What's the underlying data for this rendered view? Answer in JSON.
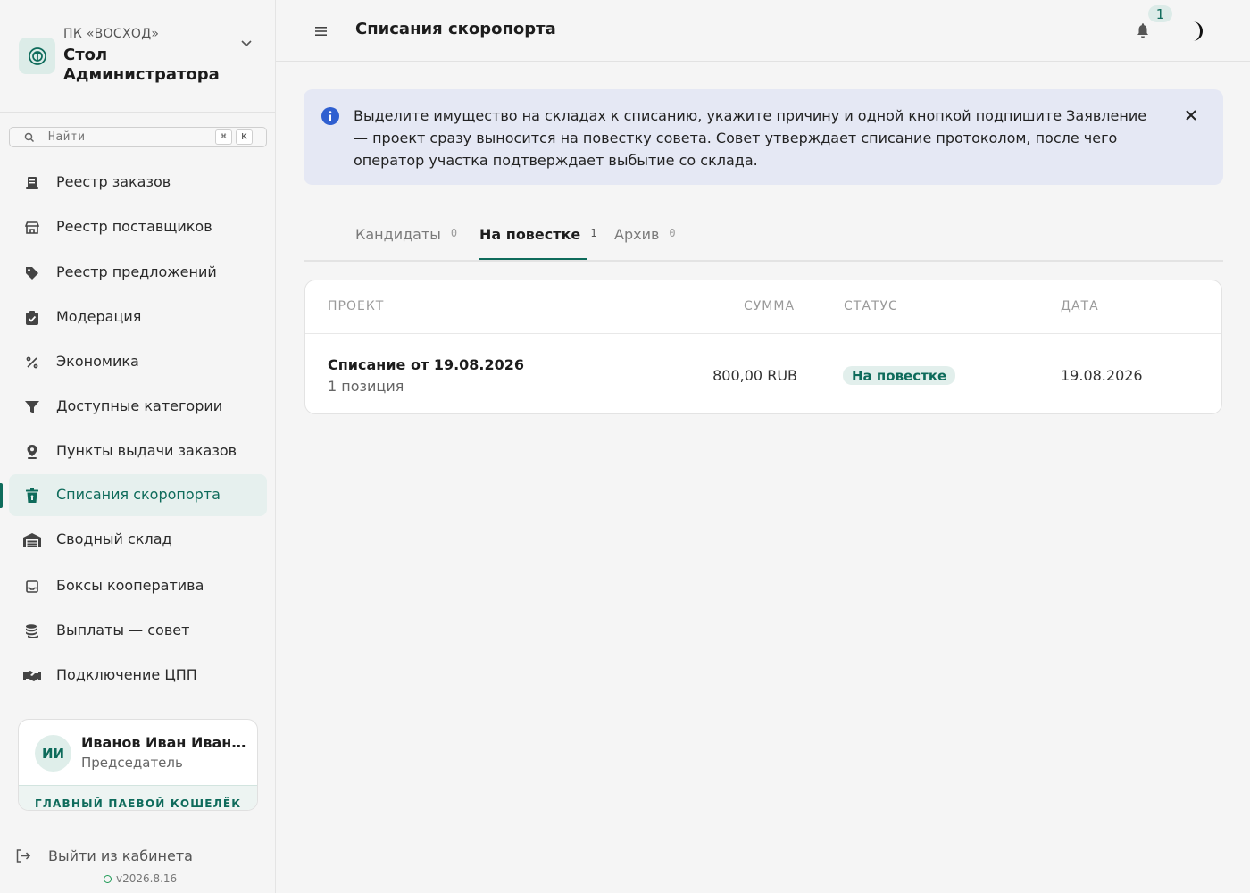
{
  "org": {
    "subtitle": "ПК «ВОСХОД»",
    "title": "Стол Администратора"
  },
  "search": {
    "placeholder": "Найти",
    "shortcut_mod": "⌘",
    "shortcut_key": "K"
  },
  "sidebar": {
    "items": [
      {
        "label": "Реестр заказов",
        "icon": "receipt-icon"
      },
      {
        "label": "Реестр поставщиков",
        "icon": "store-icon"
      },
      {
        "label": "Реестр предложений",
        "icon": "tag-icon"
      },
      {
        "label": "Модерация",
        "icon": "clipboard-check-icon"
      },
      {
        "label": "Экономика",
        "icon": "percent-icon"
      },
      {
        "label": "Доступные категории",
        "icon": "filter-icon"
      },
      {
        "label": "Пункты выдачи заказов",
        "icon": "map-pin-icon"
      },
      {
        "label": "Списания скоропорта",
        "icon": "trash-upload-icon",
        "active": true
      },
      {
        "label": "Сводный склад",
        "icon": "warehouse-icon"
      },
      {
        "label": "Боксы кооператива",
        "icon": "inbox-icon"
      },
      {
        "label": "Выплаты — совет",
        "icon": "coins-icon"
      },
      {
        "label": "Подключение ЦПП",
        "icon": "handshake-icon"
      }
    ]
  },
  "user": {
    "initials": "ИИ",
    "name": "Иванов Иван Иванович",
    "role": "Председатель",
    "wallet_label": "ГЛАВНЫЙ ПАЕВОЙ КОШЕЛЁК"
  },
  "footer": {
    "logout_label": "Выйти из кабинета",
    "version": "v2026.8.16"
  },
  "header": {
    "title": "Списания скоропорта",
    "notification_count": "1"
  },
  "banner": {
    "text": "Выделите имущество на складах к списанию, укажите причину и одной кнопкой подпишите Заявление — проект сразу выносится на повестку совета. Совет утверждает списание протоколом, после чего оператор участка подтверждает выбытие со склада."
  },
  "tabs": [
    {
      "label": "Кандидаты",
      "count": "0"
    },
    {
      "label": "На повестке",
      "count": "1",
      "active": true
    },
    {
      "label": "Архив",
      "count": "0"
    }
  ],
  "table": {
    "columns": [
      "ПРОЕКТ",
      "СУММА",
      "СТАТУС",
      "ДАТА"
    ],
    "rows": [
      {
        "title": "Списание от 19.08.2026",
        "subtitle": "1 позиция",
        "sum": "800,00 RUB",
        "status": "На повестке",
        "date": "19.08.2026"
      }
    ]
  },
  "colors": {
    "accent": "#0e6b5b",
    "banner_bg": "#e5e8f4",
    "info_icon": "#2f5fd0",
    "version_dot": "#1e9a56"
  }
}
